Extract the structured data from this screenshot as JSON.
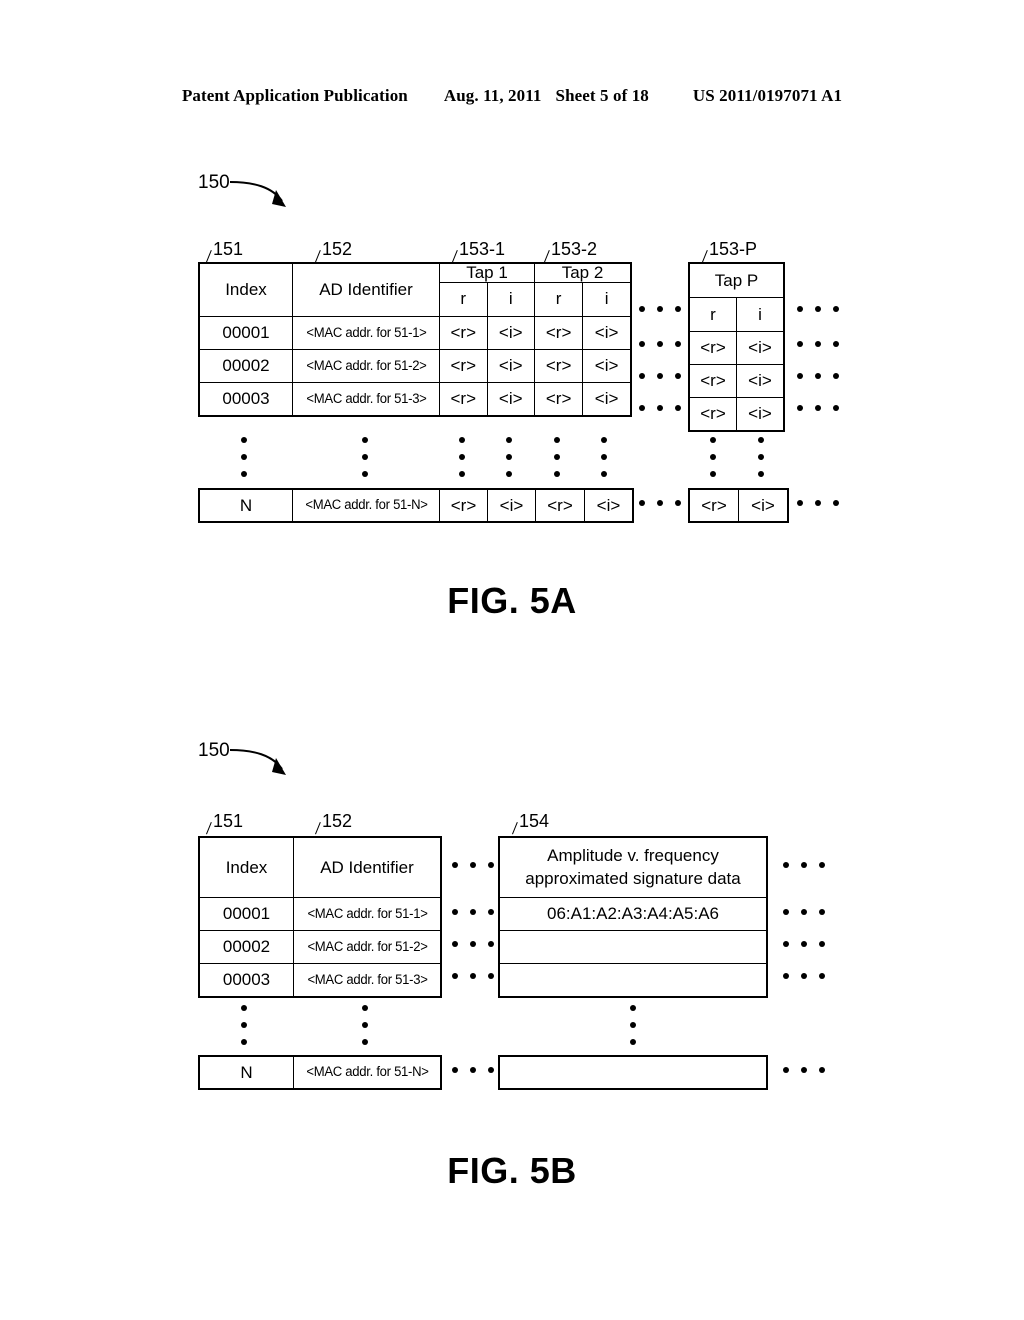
{
  "header": {
    "publication": "Patent Application Publication",
    "date": "Aug. 11, 2011",
    "sheet": "Sheet 5 of 18",
    "patent_number": "US 2011/0197071 A1"
  },
  "figures": [
    {
      "id": "fig-5a",
      "caption": "FIG. 5A",
      "table_callout": "150",
      "reference_labels": [
        "151",
        "152",
        "153-1",
        "153-2",
        "153-P"
      ],
      "columns": {
        "index": "Index",
        "ad_identifier": "AD Identifier",
        "tap1": "Tap 1",
        "tap2": "Tap 2",
        "tapP": "Tap P",
        "real": "r",
        "imag": "i"
      },
      "cell_values": {
        "real": "<r>",
        "imag": "<i>"
      },
      "rows": [
        {
          "index": "00001",
          "ad_identifier": "<MAC addr. for 51-1>"
        },
        {
          "index": "00002",
          "ad_identifier": "<MAC addr. for 51-2>"
        },
        {
          "index": "00003",
          "ad_identifier": "<MAC addr. for 51-3>"
        },
        {
          "index": "N",
          "ad_identifier": "<MAC addr. for 51-N>"
        }
      ]
    },
    {
      "id": "fig-5b",
      "caption": "FIG. 5B",
      "table_callout": "150",
      "reference_labels": [
        "151",
        "152",
        "154"
      ],
      "columns": {
        "index": "Index",
        "ad_identifier": "AD Identifier",
        "signature_line1": "Amplitude v. frequency",
        "signature_line2": "approximated signature data"
      },
      "rows": [
        {
          "index": "00001",
          "ad_identifier": "<MAC addr. for 51-1>",
          "signature": "06:A1:A2:A3:A4:A5:A6"
        },
        {
          "index": "00002",
          "ad_identifier": "<MAC addr. for 51-2>",
          "signature": ""
        },
        {
          "index": "00003",
          "ad_identifier": "<MAC addr. for 51-3>",
          "signature": ""
        },
        {
          "index": "N",
          "ad_identifier": "<MAC addr. for 51-N>",
          "signature": ""
        }
      ]
    }
  ]
}
